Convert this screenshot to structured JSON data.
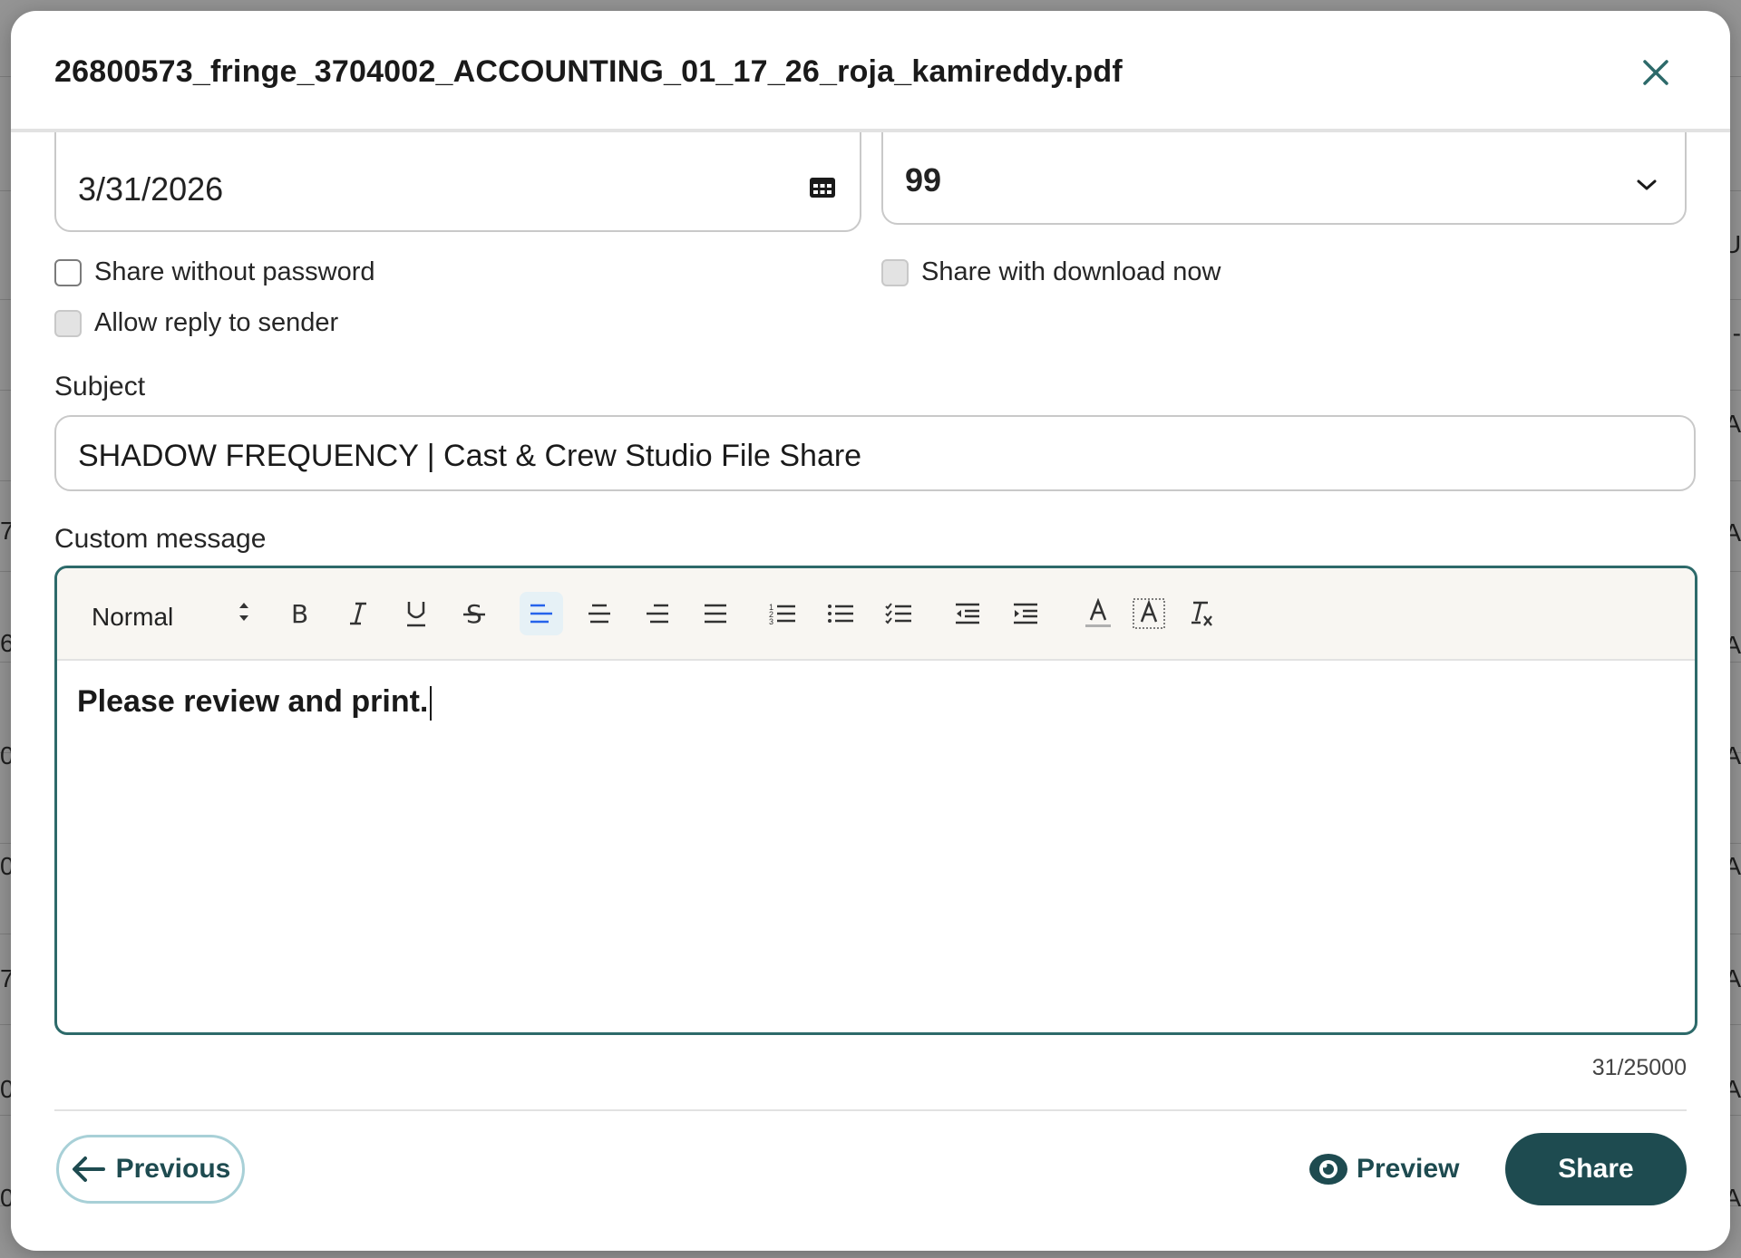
{
  "modal": {
    "title": "26800573_fringe_3704002_ACCOUNTING_01_17_26_roja_kamireddy.pdf"
  },
  "form": {
    "date_value": "3/31/2026",
    "select_value": "99",
    "checkboxes": {
      "share_without_password": "Share without password",
      "share_with_download_now": "Share with download now",
      "allow_reply_to_sender": "Allow reply to sender"
    },
    "subject_label": "Subject",
    "subject_value": "SHADOW FREQUENCY | Cast & Crew Studio File Share",
    "custom_message_label": "Custom message",
    "editor": {
      "format_select": "Normal",
      "body": "Please review and print."
    },
    "char_counter": "31/25000"
  },
  "footer": {
    "previous_label": "Previous",
    "preview_label": "Preview",
    "share_label": "Share"
  },
  "background": {
    "left_glyphs": [
      "7",
      "6",
      "0",
      "0",
      "7",
      "0",
      "0"
    ],
    "right_glyphs": [
      "U",
      "-",
      "A",
      "A",
      "A",
      "A",
      "A",
      "A",
      "A",
      "A"
    ]
  },
  "colors": {
    "accent": "#1e4b50",
    "editor_border": "#2d6a6a",
    "active_align": "#2563eb"
  }
}
